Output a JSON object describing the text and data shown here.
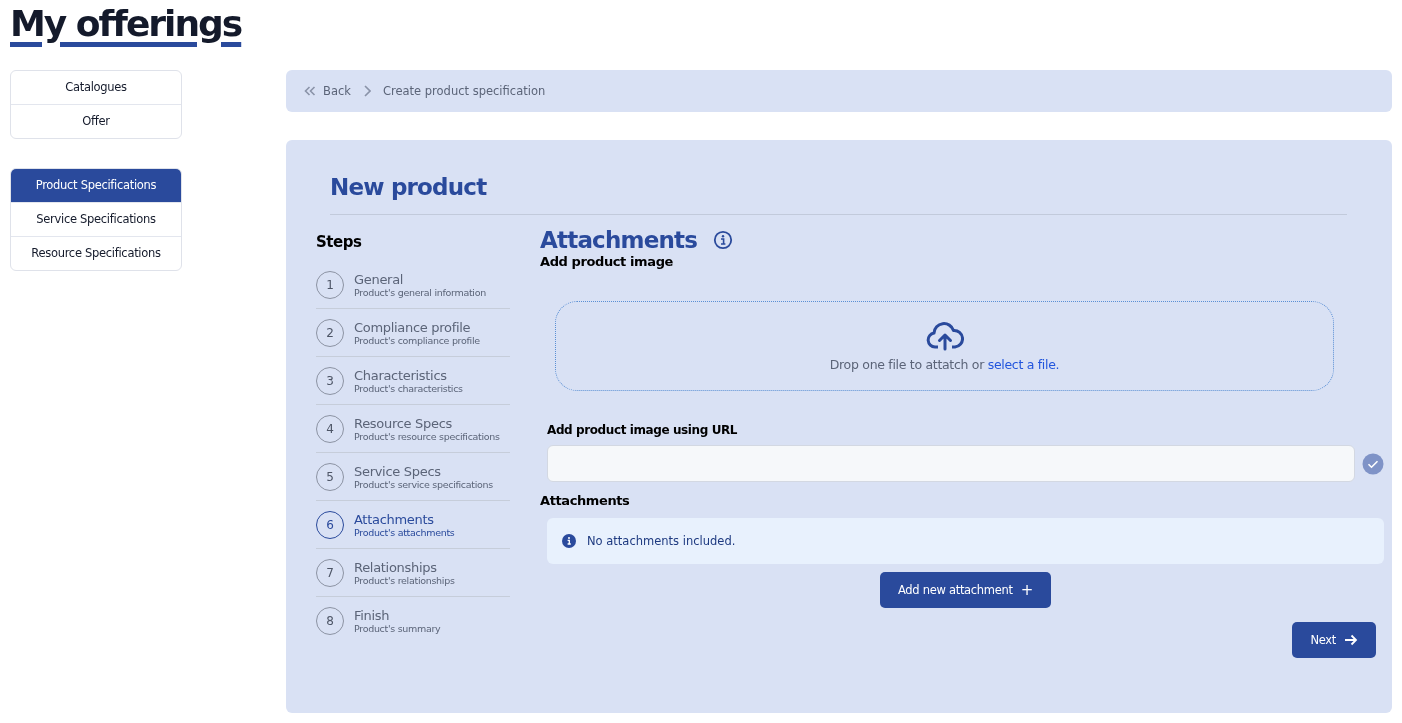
{
  "page_title": "My offerings",
  "sidebar": {
    "groups": [
      {
        "items": [
          {
            "label": "Catalogues",
            "selected": false
          },
          {
            "label": "Offer",
            "selected": false
          }
        ]
      },
      {
        "items": [
          {
            "label": "Product Specifications",
            "selected": true
          },
          {
            "label": "Service Specifications",
            "selected": false
          },
          {
            "label": "Resource Specifications",
            "selected": false
          }
        ]
      }
    ]
  },
  "breadcrumb": {
    "back": "Back",
    "current": "Create product specification"
  },
  "form": {
    "title": "New product",
    "steps_heading": "Steps",
    "steps": [
      {
        "number": "1",
        "title": "General",
        "subtitle": "Product's general information",
        "selected": false
      },
      {
        "number": "2",
        "title": "Compliance profile",
        "subtitle": "Product's compliance profile",
        "selected": false
      },
      {
        "number": "3",
        "title": "Characteristics",
        "subtitle": "Product's characteristics",
        "selected": false
      },
      {
        "number": "4",
        "title": "Resource Specs",
        "subtitle": "Product's resource specifications",
        "selected": false
      },
      {
        "number": "5",
        "title": "Service Specs",
        "subtitle": "Product's service specifications",
        "selected": false
      },
      {
        "number": "6",
        "title": "Attachments",
        "subtitle": "Product's attachments",
        "selected": true
      },
      {
        "number": "7",
        "title": "Relationships",
        "subtitle": "Product's relationships",
        "selected": false
      },
      {
        "number": "8",
        "title": "Finish",
        "subtitle": "Product's summary",
        "selected": false
      }
    ],
    "section_title": "Attachments",
    "image_label": "Add product image",
    "dropzone": {
      "text": "Drop one file to attatch or ",
      "link": "select a file."
    },
    "url_label": "Add product image using URL",
    "attachments_label": "Attachments",
    "notice": "No attachments included.",
    "add_button": "Add new attachment",
    "add_icon": "+",
    "next_button": "Next"
  }
}
